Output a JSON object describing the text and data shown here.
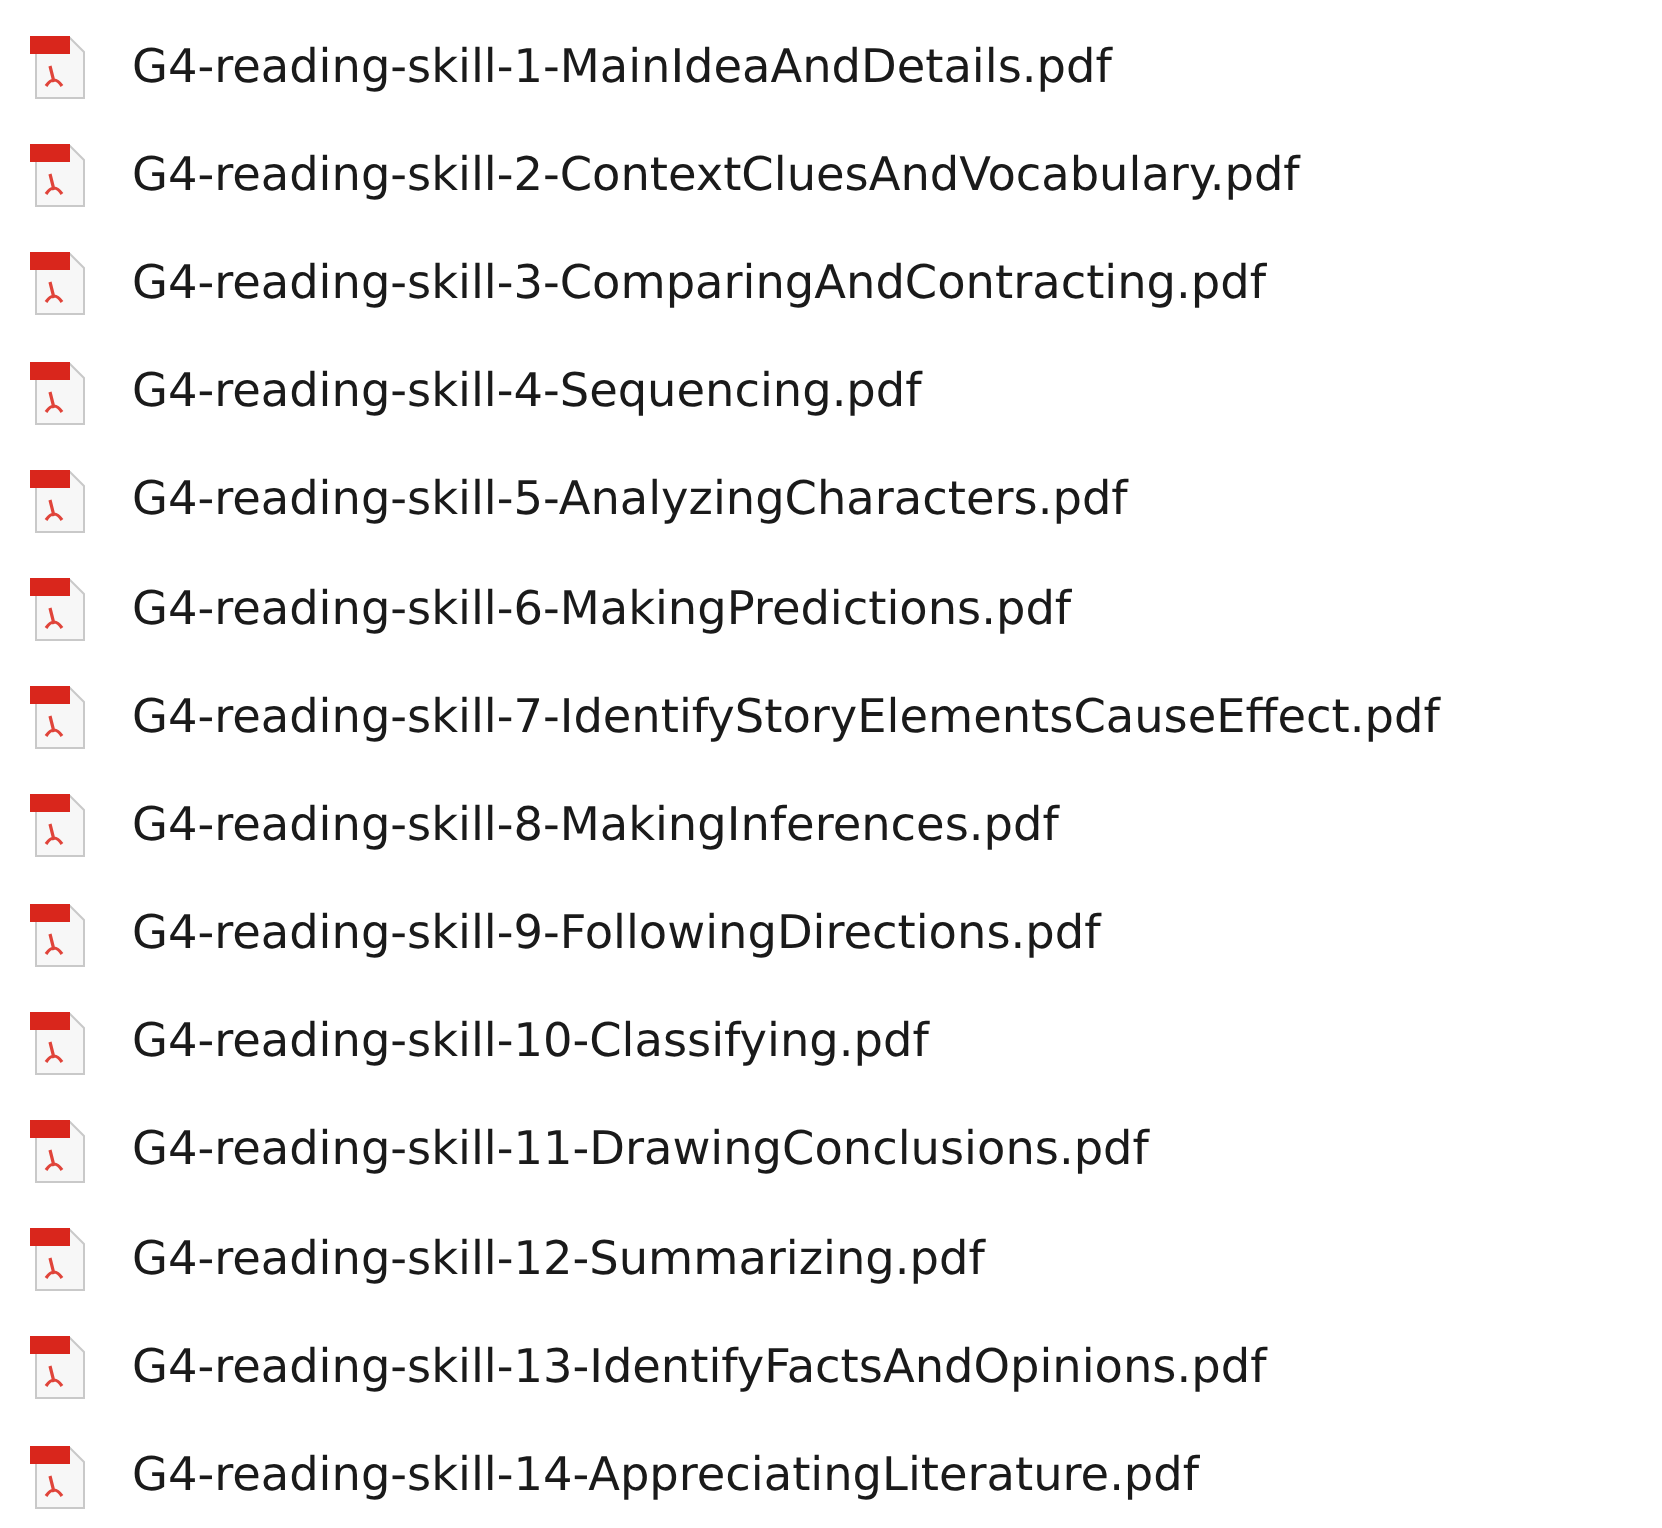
{
  "files": [
    {
      "name": "G4-reading-skill-1-MainIdeaAndDetails.pdf"
    },
    {
      "name": "G4-reading-skill-2-ContextCluesAndVocabulary.pdf"
    },
    {
      "name": "G4-reading-skill-3-ComparingAndContracting.pdf"
    },
    {
      "name": "G4-reading-skill-4-Sequencing.pdf"
    },
    {
      "name": "G4-reading-skill-5-AnalyzingCharacters.pdf"
    },
    {
      "name": "G4-reading-skill-6-MakingPredictions.pdf"
    },
    {
      "name": "G4-reading-skill-7-IdentifyStoryElementsCauseEffect.pdf"
    },
    {
      "name": "G4-reading-skill-8-MakingInferences.pdf"
    },
    {
      "name": "G4-reading-skill-9-FollowingDirections.pdf"
    },
    {
      "name": "G4-reading-skill-10-Classifying.pdf"
    },
    {
      "name": "G4-reading-skill-11-DrawingConclusions.pdf"
    },
    {
      "name": "G4-reading-skill-12-Summarizing.pdf"
    },
    {
      "name": "G4-reading-skill-13-IdentifyFactsAndOpinions.pdf"
    },
    {
      "name": "G4-reading-skill-14-AppreciatingLiterature.pdf"
    }
  ]
}
